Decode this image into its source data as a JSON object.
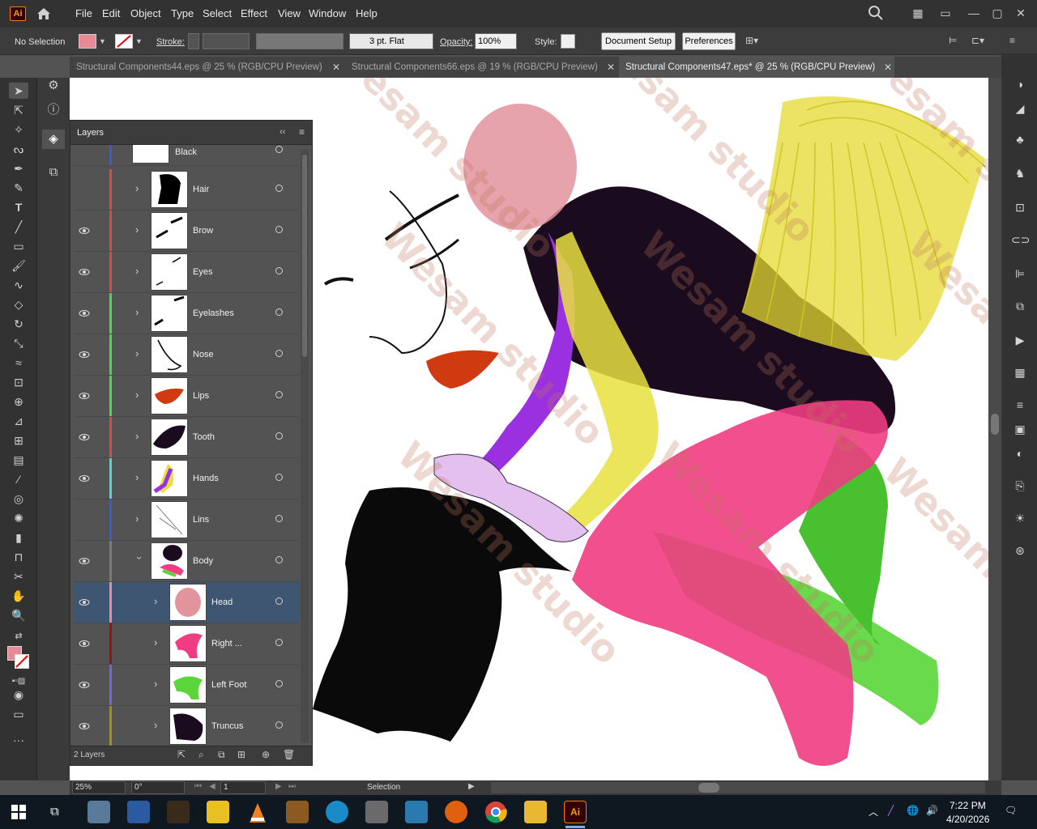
{
  "app": {
    "logo": "Ai"
  },
  "menu": [
    "File",
    "Edit",
    "Object",
    "Type",
    "Select",
    "Effect",
    "View",
    "Window",
    "Help"
  ],
  "control": {
    "selection": "No Selection",
    "stroke_label": "Stroke:",
    "brush": "3 pt. Flat",
    "opacity_label": "Opacity:",
    "opacity_value": "100%",
    "style_label": "Style:",
    "document_setup": "Document Setup",
    "preferences": "Preferences"
  },
  "tabs": [
    {
      "label": "Structural Components44.eps @ 25 % (RGB/CPU Preview)"
    },
    {
      "label": "Structural Components66.eps @ 19 % (RGB/CPU Preview)"
    },
    {
      "label": "Structural Components47.eps* @ 25 % (RGB/CPU Preview)"
    }
  ],
  "layers_panel": {
    "title": "Layers",
    "rows": [
      {
        "name": "Black",
        "color": "#3a5bd9",
        "eye": false
      },
      {
        "name": "Hair",
        "color": "#d94a4a",
        "eye": false
      },
      {
        "name": "Brow",
        "color": "#d94a4a",
        "eye": true
      },
      {
        "name": "Eyes",
        "color": "#d94a4a",
        "eye": true
      },
      {
        "name": "Eyelashes",
        "color": "#4ad94a",
        "eye": true
      },
      {
        "name": "Nose",
        "color": "#4ad94a",
        "eye": true
      },
      {
        "name": "Lips",
        "color": "#4ad94a",
        "eye": true
      },
      {
        "name": "Tooth",
        "color": "#d94a4a",
        "eye": true
      },
      {
        "name": "Hands",
        "color": "#4ad9d9",
        "eye": true
      },
      {
        "name": "Lins",
        "color": "#3a5bd9",
        "eye": false
      },
      {
        "name": "Body",
        "color": "#7a7a7a",
        "eye": true
      },
      {
        "name": "Head",
        "color": "#e88aa0",
        "eye": true,
        "selected": true
      },
      {
        "name": "Right ...",
        "color": "#a01010",
        "eye": true
      },
      {
        "name": "Left Foot",
        "color": "#6a6ad9",
        "eye": true
      },
      {
        "name": "Truncus",
        "color": "#9a9a00",
        "eye": true
      }
    ],
    "footer": "2 Layers"
  },
  "status": {
    "zoom": "25%",
    "rotate": "0°",
    "artboard": "1",
    "tool": "Selection"
  },
  "watermark": "Wesam studio",
  "taskbar": {
    "time": "7:22 PM",
    "date": "4/20/2026",
    "app_label": "Ai"
  }
}
